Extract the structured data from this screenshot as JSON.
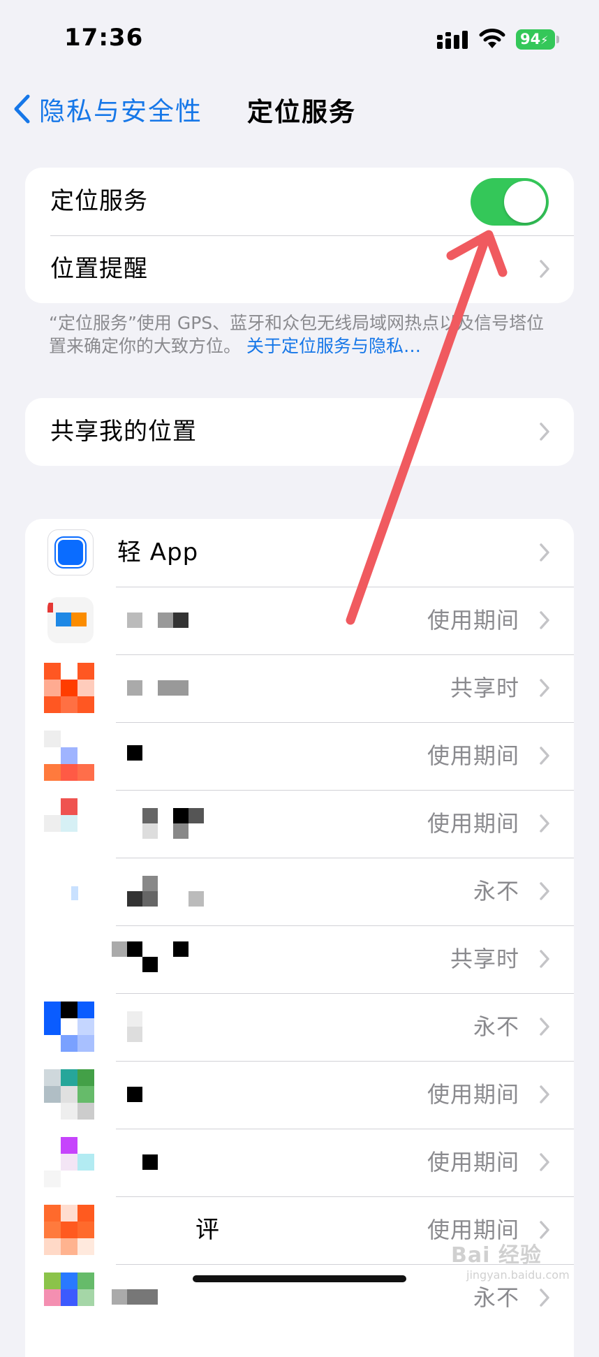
{
  "status": {
    "time": "17:36",
    "battery": "94"
  },
  "nav": {
    "back_label": "隐私与安全性",
    "title": "定位服务"
  },
  "location_group": {
    "toggle_label": "定位服务",
    "toggle_on": true,
    "alerts_label": "位置提醒"
  },
  "footer": {
    "text": "“定位服务”使用 GPS、蓝牙和众包无线局域网热点以及信号塔位置来确定你的大致方位。",
    "link": "关于定位服务与隐私…"
  },
  "share": {
    "label": "共享我的位置"
  },
  "apps": [
    {
      "name": "轻 App",
      "status": ""
    },
    {
      "name": "",
      "status": "使用期间"
    },
    {
      "name": "",
      "status": "共享时"
    },
    {
      "name": "",
      "status": "使用期间"
    },
    {
      "name": "",
      "status": "使用期间"
    },
    {
      "name": "",
      "status": "永不"
    },
    {
      "name": "",
      "status": "共享时"
    },
    {
      "name": "",
      "status": "永不"
    },
    {
      "name": "",
      "status": "使用期间"
    },
    {
      "name": "",
      "status": "使用期间"
    },
    {
      "name": "评",
      "status": "使用期间"
    },
    {
      "name": "",
      "status": "永不"
    }
  ],
  "colors": {
    "accent": "#1677e8",
    "toggle_on": "#34c759",
    "annotation_arrow": "#f05a5f"
  },
  "watermark": {
    "brand": "Bai 经验",
    "url": "jingyan.baidu.com"
  }
}
